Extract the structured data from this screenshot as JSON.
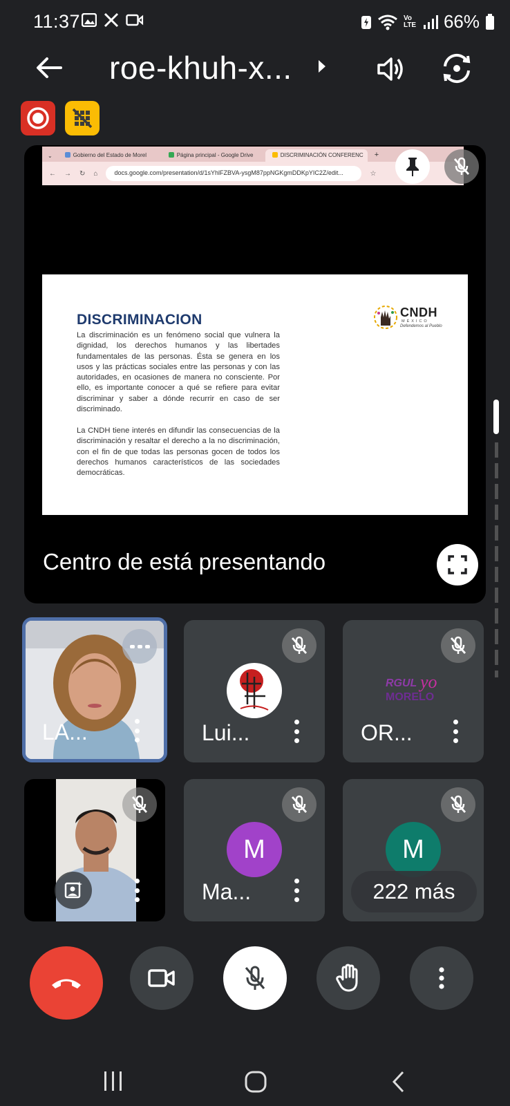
{
  "status_bar": {
    "time": "11:37",
    "battery": "66%",
    "network": "Vo LTE"
  },
  "header": {
    "meeting_code": "roe-khuh-x...",
    "back_icon": "arrow-left-icon",
    "audio_icon": "speaker-icon",
    "camera_switch_icon": "camera-flip-icon"
  },
  "indicators": {
    "recording_icon": "record-icon",
    "no_capture_icon": "grid-off-icon"
  },
  "presentation": {
    "browser_tabs": [
      "Gobierno del Estado de Morel",
      "Página principal - Google Drive",
      "DISCRIMINACIÓN CONFERENC"
    ],
    "url": "docs.google.com/presentation/d/1sYhlFZBVA-ysgM87ppNGKgmDDKpYIC2Z/edit...",
    "slide": {
      "title": "DISCRIMINACION",
      "paragraph1": "La discriminación es un fenómeno social que vulnera la dignidad, los derechos humanos y las libertades fundamentales de las personas. Ésta se genera en los usos y las prácticas sociales entre las personas y con las autoridades, en ocasiones de manera no consciente. Por ello, es importante conocer a qué se refiere para evitar discriminar y saber a dónde recurrir en caso de ser discriminado.",
      "paragraph2": "La CNDH tiene interés en difundir las consecuencias de la discriminación y resaltar el derecho a la no discriminación, con el fin de que todas las personas gocen de todos los derechos humanos característicos de las sociedades democráticas.",
      "logo_name": "CNDH",
      "logo_country": "MÉXICO",
      "logo_tagline": "Defendemos al Pueblo"
    },
    "presenter_label": "Centro de está presentando"
  },
  "participants": [
    {
      "name": "LA...",
      "type": "video",
      "speaking": true
    },
    {
      "name": "Lui...",
      "type": "image",
      "muted": true
    },
    {
      "name": "OR...",
      "type": "logo",
      "muted": true,
      "logo_text": "ORGULLO MORELOS"
    },
    {
      "name": "",
      "type": "video",
      "muted": true
    },
    {
      "name": "Ma...",
      "type": "initial",
      "initial": "M",
      "color": "#a142c9",
      "muted": true
    },
    {
      "name": "",
      "type": "initial",
      "initial": "M",
      "color": "#0e7c6b",
      "muted": true,
      "overflow_label": "222 más"
    }
  ],
  "controls": {
    "end_call_icon": "hangup-icon",
    "camera_icon": "video-camera-icon",
    "mic_icon": "mic-off-icon",
    "hand_icon": "raise-hand-icon",
    "more_icon": "more-vertical-icon"
  },
  "colors": {
    "end_call": "#ea4335",
    "recording": "#d93025",
    "no_capture": "#fbbc04",
    "active_speaker_border": "#4f6fa8"
  }
}
